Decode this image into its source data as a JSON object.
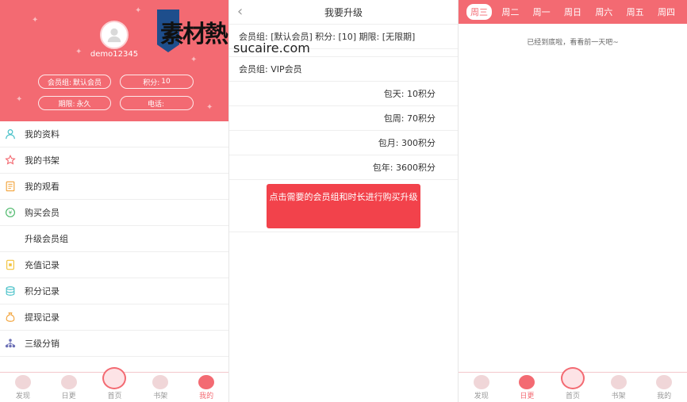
{
  "profile": {
    "username": "demo12345",
    "group_label": "会员组:",
    "group_value": "默认会员",
    "points_label": "积分:",
    "points_value": "10",
    "expire_label": "期限:",
    "expire_value": "永久",
    "phone_label": "电话:",
    "phone_value": ""
  },
  "watermark": {
    "logo_text": "素材熱",
    "url_text": "sucaire.com"
  },
  "menu": [
    {
      "label": "我的资料",
      "icon": "user-icon",
      "color": "#47c1c8"
    },
    {
      "label": "我的书架",
      "icon": "star-icon",
      "color": "#f36a72"
    },
    {
      "label": "我的观看",
      "icon": "document-icon",
      "color": "#f2a33a"
    },
    {
      "label": "购买会员",
      "icon": "coin-icon",
      "color": "#4cb86a"
    },
    {
      "label": "升级会员组",
      "icon": "",
      "color": ""
    },
    {
      "label": "充值记录",
      "icon": "wallet-icon",
      "color": "#f2c23a"
    },
    {
      "label": "积分记录",
      "icon": "database-icon",
      "color": "#47c1c8"
    },
    {
      "label": "提现记录",
      "icon": "money-bag-icon",
      "color": "#f2a33a"
    },
    {
      "label": "三级分销",
      "icon": "network-icon",
      "color": "#6b6fb5"
    }
  ],
  "tabs": [
    {
      "label": "发现"
    },
    {
      "label": "日更"
    },
    {
      "label": "首页"
    },
    {
      "label": "书架"
    },
    {
      "label": "我的"
    }
  ],
  "upgrade": {
    "title": "我要升级",
    "info_text": "会员组: [默认会员] 积分: [10] 期限: [无限期]",
    "group_label": "会员组: VIP会员",
    "options": [
      "包天: 10积分",
      "包周: 70积分",
      "包月: 300积分",
      "包年: 3600积分"
    ],
    "buy_button": "点击需要的会员组和时长进行购买升级"
  },
  "schedule": {
    "days": [
      "周三",
      "周二",
      "周一",
      "周日",
      "周六",
      "周五",
      "周四"
    ],
    "active_day": "周三",
    "empty_text": "已经到底啦，看看前一天吧~"
  },
  "colors": {
    "brand": "#f36a72",
    "buy_button": "#f2424b"
  }
}
